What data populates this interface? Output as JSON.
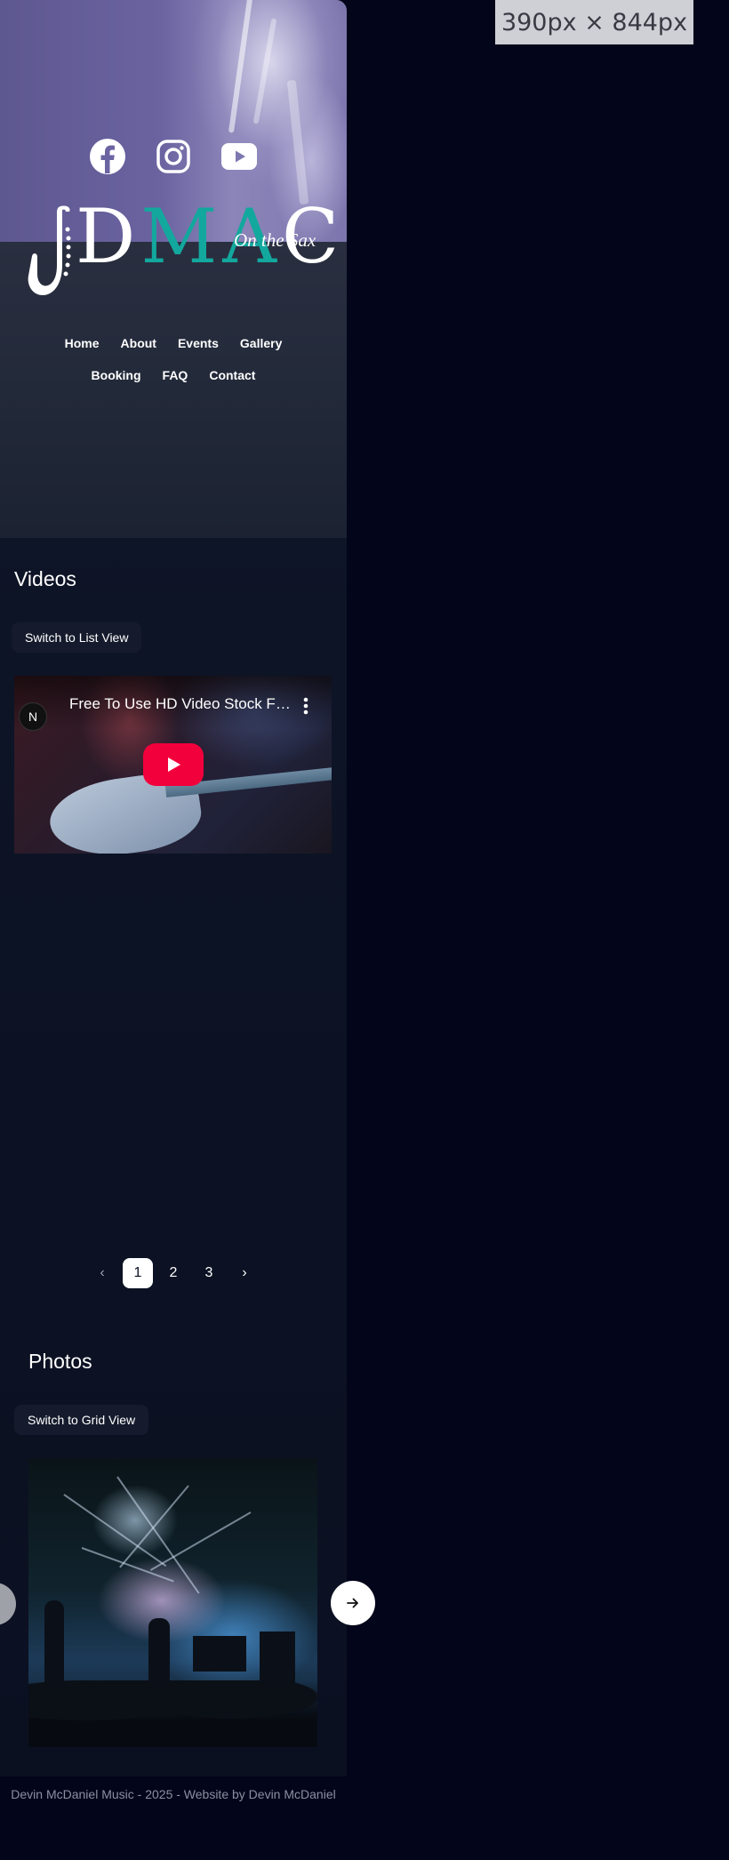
{
  "viewport_badge": "390px × 844px",
  "social": {
    "facebook": "facebook-icon",
    "instagram": "instagram-icon",
    "youtube": "youtube-icon"
  },
  "logo": {
    "letters": [
      "D",
      "M",
      "A",
      "C"
    ],
    "tagline": "On the Sax"
  },
  "nav": {
    "row1": [
      "Home",
      "About",
      "Events",
      "Gallery"
    ],
    "row2": [
      "Booking",
      "FAQ",
      "Contact"
    ]
  },
  "videos": {
    "title": "Videos",
    "toggle_label": "Switch to List View",
    "video_title": "Free To Use HD Video Stock Footage",
    "channel_initial": "N"
  },
  "pagination": {
    "prev": "‹",
    "pages": [
      "1",
      "2",
      "3"
    ],
    "current": "1",
    "next": "›"
  },
  "photos": {
    "title": "Photos",
    "toggle_label": "Switch to Grid View",
    "next_arrow": "→"
  },
  "footer": "Devin McDaniel Music - 2025 - Website by Devin McDaniel",
  "colors": {
    "background": "#03051a",
    "accent": "#13a89e",
    "play_red": "#f2003c"
  }
}
